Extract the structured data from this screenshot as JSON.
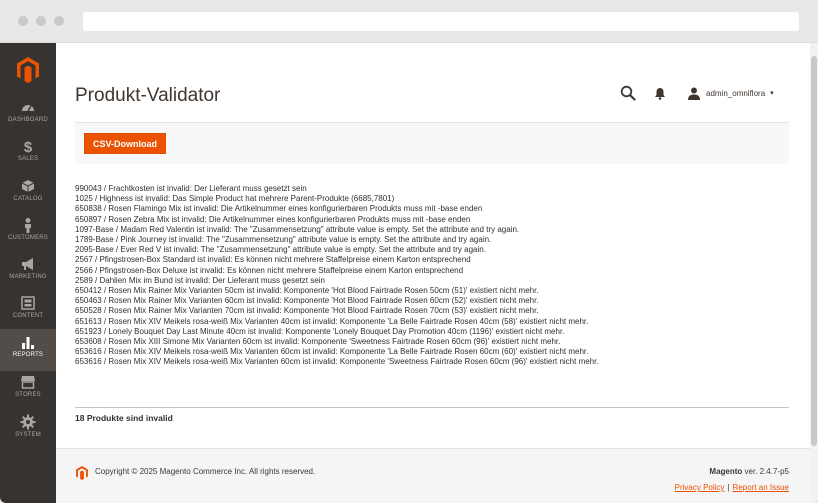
{
  "header": {
    "title": "Produkt-Validator",
    "user": "admin_omniflora",
    "caret": "▾"
  },
  "sidebar": {
    "items": [
      {
        "label": "DASHBOARD",
        "icon": "dashboard-icon"
      },
      {
        "label": "SALES",
        "icon": "dollar-icon"
      },
      {
        "label": "CATALOG",
        "icon": "box-icon"
      },
      {
        "label": "CUSTOMERS",
        "icon": "person-icon"
      },
      {
        "label": "MARKETING",
        "icon": "megaphone-icon"
      },
      {
        "label": "CONTENT",
        "icon": "content-icon"
      },
      {
        "label": "REPORTS",
        "icon": "bar-chart-icon",
        "active": true
      },
      {
        "label": "STORES",
        "icon": "store-icon"
      },
      {
        "label": "SYSTEM",
        "icon": "gear-icon"
      }
    ]
  },
  "actions": {
    "csv_label": "CSV-Download"
  },
  "log": [
    "990043 / Frachtkosten ist invalid: Der Lieferant muss gesetzt sein",
    "1025 / Highness ist invalid: Das Simple Product hat mehrere Parent-Produkte (6685,7801)",
    "650838 / Rosen Flamingo Mix ist invalid: Die Artikelnummer eines konfigurierbaren Produkts muss mit -base enden",
    "650897 / Rosen Zebra Mix ist invalid: Die Artikelnummer eines konfigurierbaren Produkts muss mit -base enden",
    "1097-Base / Madam Red Valentin ist invalid: The \"Zusammensetzung\" attribute value is empty. Set the attribute and try again.",
    "1789-Base / Pink Journey ist invalid: The \"Zusammensetzung\" attribute value is empty. Set the attribute and try again.",
    "2095-Base / Ever Red V ist invalid: The \"Zusammensetzung\" attribute value is empty. Set the attribute and try again.",
    "2567 / Pfingstrosen-Box Standard ist invalid: Es können nicht mehrere Staffelpreise einem Karton entsprechend",
    "2566 / Pfingstrosen-Box Deluxe ist invalid: Es können nicht mehrere Staffelpreise einem Karton entsprechend",
    "2589 / Dahlien Mix im Bund ist invalid: Der Lieferant muss gesetzt sein",
    "650412 / Rosen Mix Rainer Mix Varianten 50cm ist invalid: Komponente 'Hot Blood Fairtrade Rosen 50cm (51)' existiert nicht mehr.",
    "650463 / Rosen Mix Rainer Mix Varianten 60cm ist invalid: Komponente 'Hot Blood Fairtrade Rosen 60cm (52)' existiert nicht mehr.",
    "650528 / Rosen Mix Rainer Mix Varianten 70cm ist invalid: Komponente 'Hot Blood Fairtrade Rosen 70cm (53)' existiert nicht mehr.",
    "651613 / Rosen Mix XIV Meikels rosa-weiß Mix Varianten 40cm ist invalid: Komponente 'La Belle Fairtrade Rosen 40cm (58)' existiert nicht mehr.",
    "651923 / Lonely Bouquet Day Last Minute 40cm ist invalid: Komponente 'Lonely Bouquet Day Promotion 40cm (1196)' existiert nicht mehr.",
    "653608 / Rosen Mix XIII Simone Mix Varianten 60cm ist invalid: Komponente 'Sweetness Fairtrade Rosen 60cm (96)' existiert nicht mehr.",
    "653616 / Rosen Mix XIV Meikels rosa-weiß Mix Varianten 60cm ist invalid: Komponente 'La Belle Fairtrade Rosen 60cm (60)' existiert nicht mehr.",
    "653616 / Rosen Mix XIV Meikels rosa-weiß Mix Varianten 60cm ist invalid: Komponente 'Sweetness Fairtrade Rosen 60cm (96)' existiert nicht mehr."
  ],
  "summary": "18 Produkte sind invalid",
  "footer": {
    "copyright": "Copyright © 2025 Magento Commerce Inc. All rights reserved.",
    "brand": "Magento",
    "version": " ver. 2.4.7-p5",
    "privacy": "Privacy Policy",
    "separator": "|",
    "report": "Report an Issue"
  },
  "colors": {
    "accent": "#eb5202",
    "sidebar_bg": "#373330",
    "sidebar_active": "#524d49"
  }
}
